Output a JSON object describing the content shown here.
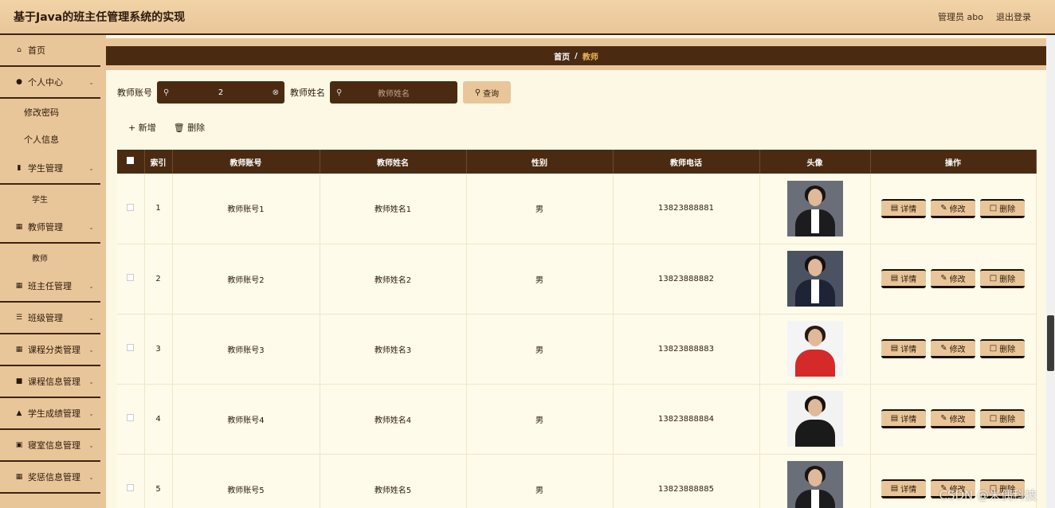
{
  "header": {
    "title": "基于Java的班主任管理系统的实现",
    "admin": "管理员 abo",
    "logout": "退出登录"
  },
  "sidebar": {
    "home": "首页",
    "personal": "个人中心",
    "change_password": "修改密码",
    "personal_info": "个人信息",
    "student_mgmt": "学生管理",
    "student": "学生",
    "teacher_mgmt": "教师管理",
    "teacher": "教师",
    "headteacher_mgmt": "班主任管理",
    "class_mgmt": "班级管理",
    "course_cat_mgmt": "课程分类管理",
    "course_info_mgmt": "课程信息管理",
    "score_mgmt": "学生成绩管理",
    "dorm_mgmt": "寝室信息管理",
    "reward_mgmt": "奖惩信息管理"
  },
  "breadcrumb": {
    "home": "首页",
    "sep": "/",
    "current": "教师"
  },
  "search": {
    "account_label": "教师账号",
    "account_value": "2",
    "name_label": "教师姓名",
    "name_placeholder": "教师姓名",
    "query": "查询"
  },
  "actions": {
    "add": "新增",
    "delete": "删除"
  },
  "table": {
    "headers": [
      "索引",
      "教师账号",
      "教师姓名",
      "性别",
      "教师电话",
      "头像",
      "操作"
    ],
    "rows": [
      {
        "index": "1",
        "account": "教师账号1",
        "name": "教师姓名1",
        "gender": "男",
        "phone": "13823888881"
      },
      {
        "index": "2",
        "account": "教师账号2",
        "name": "教师姓名2",
        "gender": "男",
        "phone": "13823888882"
      },
      {
        "index": "3",
        "account": "教师账号3",
        "name": "教师姓名3",
        "gender": "男",
        "phone": "13823888883"
      },
      {
        "index": "4",
        "account": "教师账号4",
        "name": "教师姓名4",
        "gender": "男",
        "phone": "13823888884"
      },
      {
        "index": "5",
        "account": "教师账号5",
        "name": "教师姓名5",
        "gender": "男",
        "phone": "13823888885"
      }
    ],
    "op_detail": "详情",
    "op_edit": "修改",
    "op_delete": "删除"
  },
  "watermark": "CSDN @米偶科技",
  "colors": {
    "header_bg": "#e9c69a",
    "dark_brown": "#4a2b12",
    "page_bg": "#fdf8e4",
    "accent": "#e9b35a"
  }
}
